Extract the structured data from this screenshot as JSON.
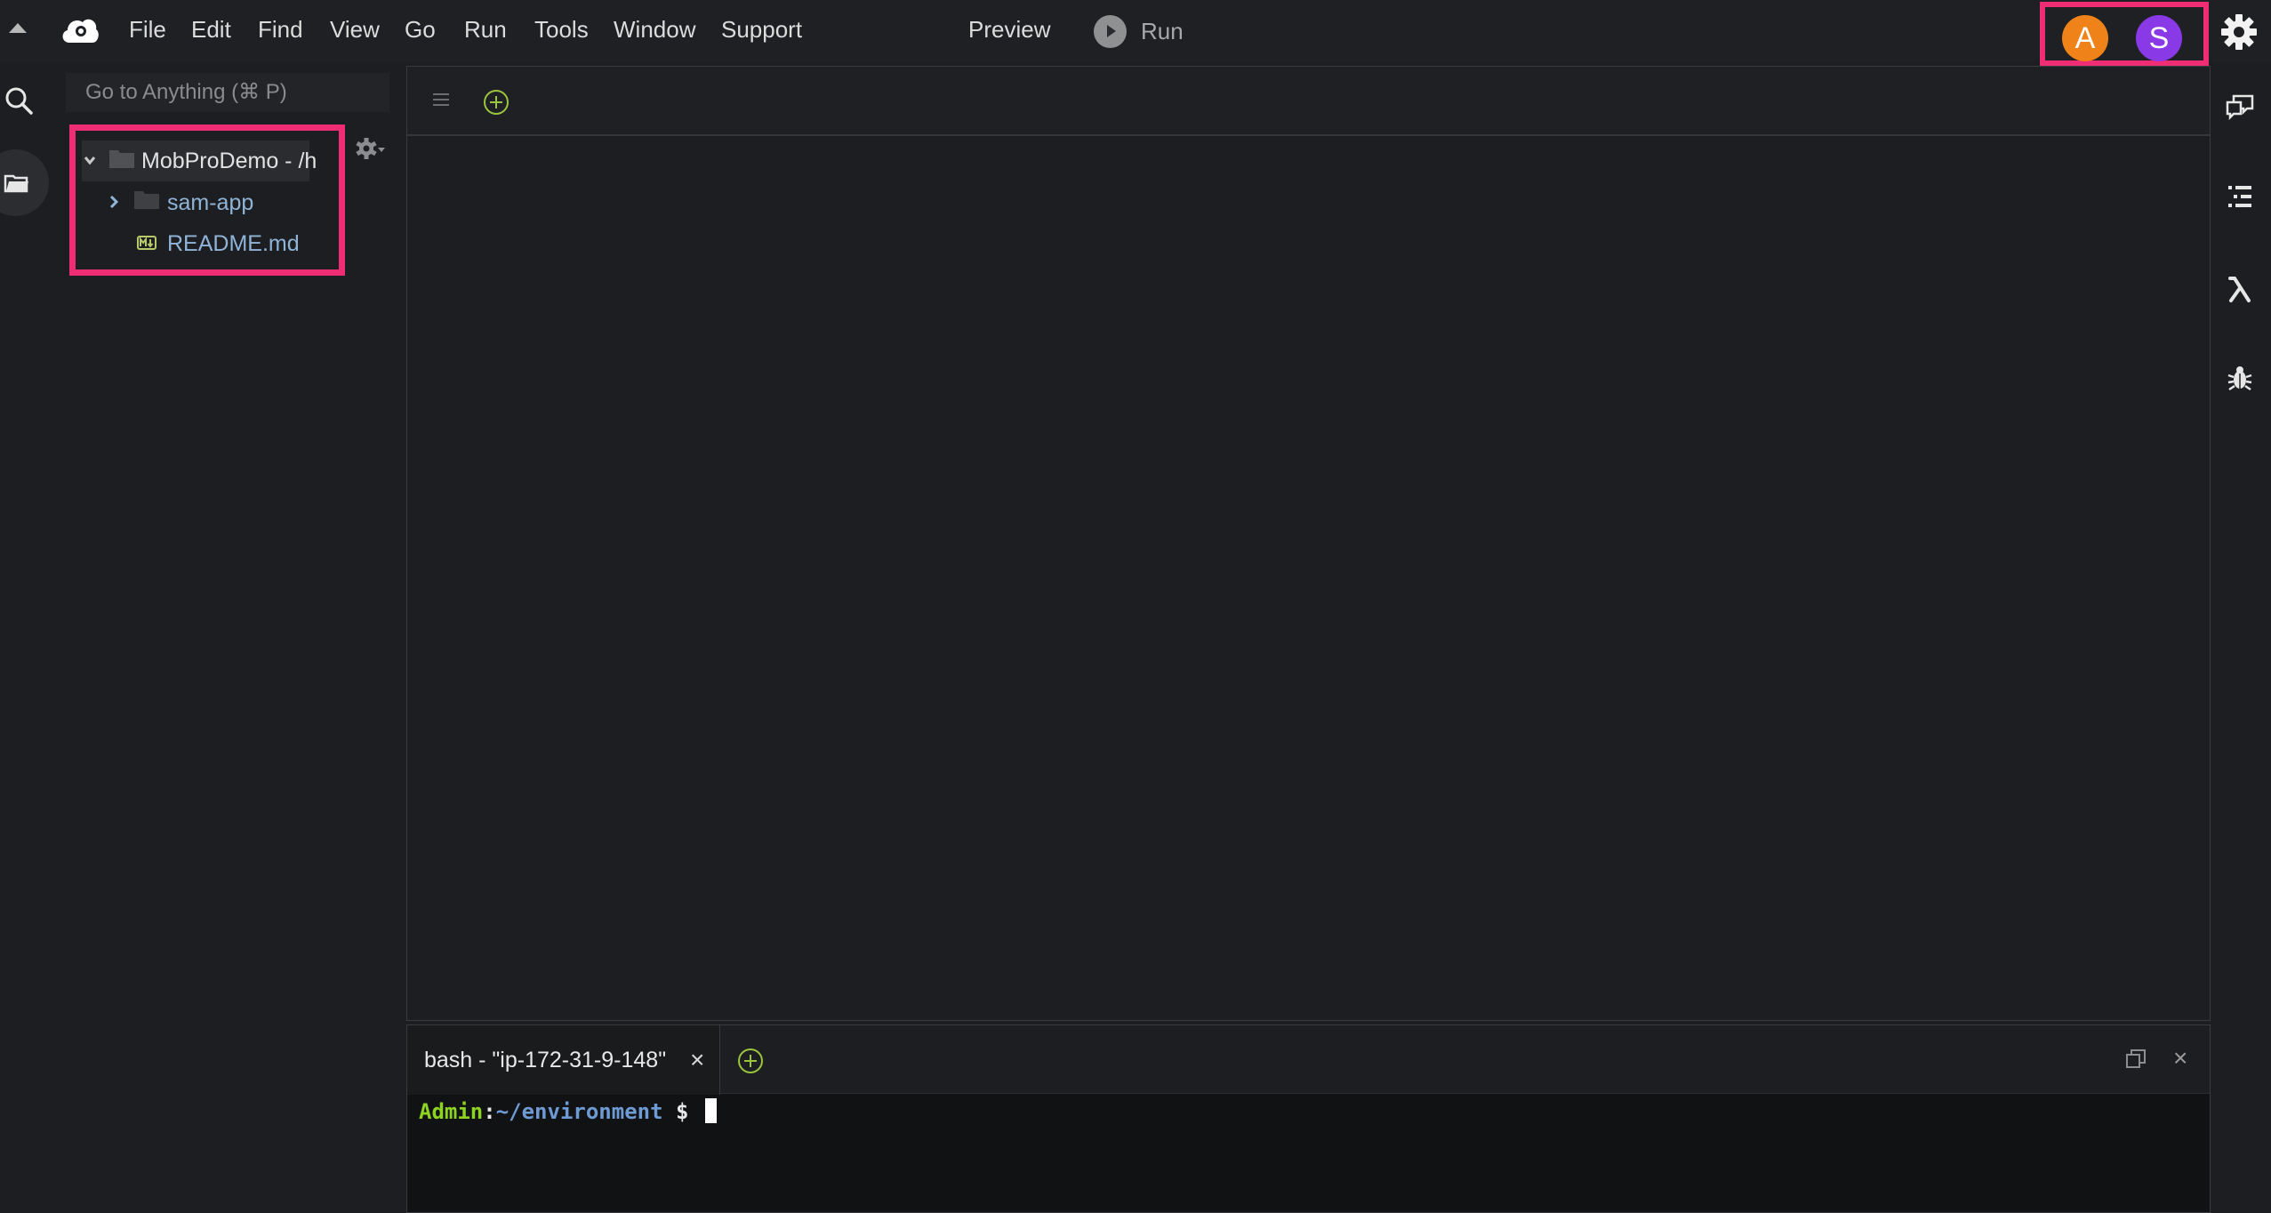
{
  "menubar": {
    "items": [
      "File",
      "Edit",
      "Find",
      "View",
      "Go",
      "Run",
      "Tools",
      "Window",
      "Support"
    ],
    "preview_label": "Preview",
    "run_label": "Run"
  },
  "collaborators": [
    "A",
    "S"
  ],
  "colors": {
    "highlight": "#ee2d74",
    "avatar_a": "#ef8218",
    "avatar_s": "#8a39e6",
    "prompt_user": "#8ed322",
    "prompt_path": "#6f9bd5"
  },
  "sidebar": {
    "search_placeholder": "Go to Anything (⌘ P)",
    "tree": {
      "root": "MobProDemo - /h",
      "children": [
        {
          "label": "sam-app",
          "type": "folder"
        },
        {
          "label": "README.md",
          "type": "markdown-file"
        }
      ]
    }
  },
  "icons": {
    "top": [
      "collapse-toggle-icon",
      "cloud9-logo-icon",
      "play-icon",
      "settings-gear-icon"
    ],
    "left_rail": [
      "search-icon",
      "environment-folder-icon"
    ],
    "right_rail": [
      "collaborate-chat-icon",
      "outline-list-icon",
      "aws-lambda-icon",
      "debugger-bug-icon"
    ]
  },
  "terminal": {
    "tab_label": "bash - \"ip-172-31-9-148\"",
    "close_glyph": "×",
    "prompt_user": "Admin",
    "prompt_sep": ":",
    "prompt_path": "~/environment",
    "prompt_symbol": " $ "
  }
}
